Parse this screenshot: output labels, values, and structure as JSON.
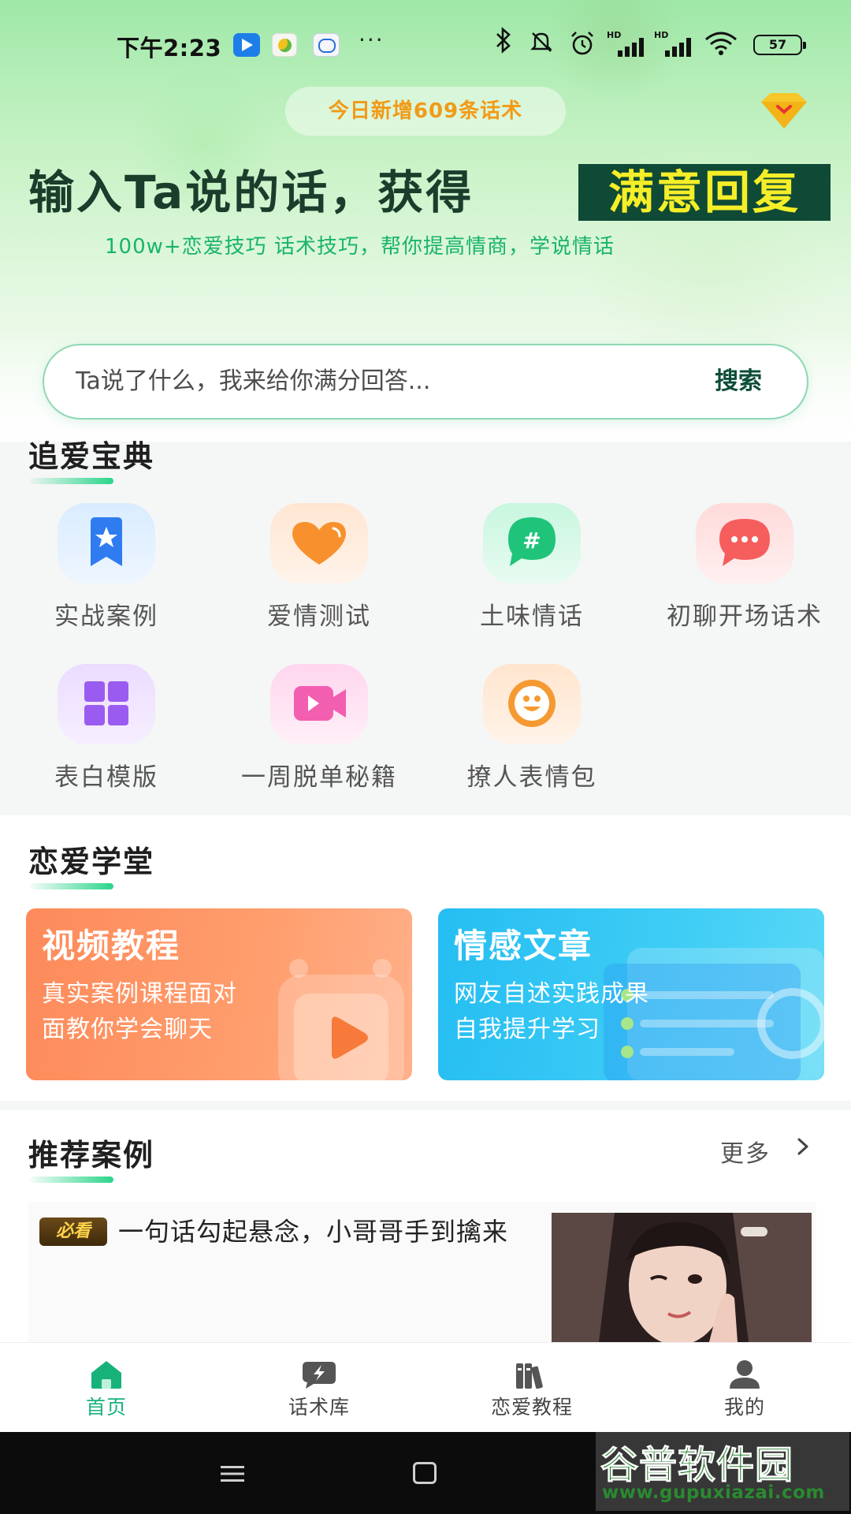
{
  "status_bar": {
    "time": "下午2:23",
    "overflow": "···",
    "battery": "57",
    "signal_label": "HD"
  },
  "hero": {
    "promo": "今日新增609条话术",
    "headline": "输入Ta说的话，获得",
    "headline_highlight": "满意回复",
    "subline": "100w+恋爱技巧 话术技巧，帮你提高情商，学说情话"
  },
  "search": {
    "placeholder": "Ta说了什么，我来给你满分回答...",
    "button": "搜索"
  },
  "guide": {
    "title": "追爱宝典",
    "items": [
      {
        "label": "实战案例",
        "icon": "bookmark-star-icon",
        "color": "#2f7cf0"
      },
      {
        "label": "爱情测试",
        "icon": "heart-icon",
        "color": "#f8912d"
      },
      {
        "label": "土味情话",
        "icon": "hashtag-chat-icon",
        "color": "#1fc47a"
      },
      {
        "label": "初聊开场话术",
        "icon": "chat-bubble-icon",
        "color": "#f65d5d"
      },
      {
        "label": "表白模版",
        "icon": "template-grid-icon",
        "color": "#9a5cf0"
      },
      {
        "label": "一周脱单秘籍",
        "icon": "video-icon",
        "color": "#f25fb0"
      },
      {
        "label": "撩人表情包",
        "icon": "smiley-icon",
        "color": "#f59a33"
      }
    ]
  },
  "school": {
    "title": "恋爱学堂",
    "cards": [
      {
        "title": "视频教程",
        "desc_1": "真实案例课程面对",
        "desc_2": "面教你学会聊天",
        "color": "#fb8f5f"
      },
      {
        "title": "情感文章",
        "desc_1": "网友自述实践成果",
        "desc_2": "自我提升学习",
        "color": "#2fc6f2"
      }
    ]
  },
  "recommend": {
    "title": "推荐案例",
    "more": "更多",
    "article": {
      "badge": "必看",
      "title": "一句话勾起悬念，小哥哥手到擒来"
    }
  },
  "tabbar": {
    "tabs": [
      {
        "label": "首页",
        "icon": "home-icon",
        "active": true
      },
      {
        "label": "话术库",
        "icon": "lightning-chat-icon",
        "active": false
      },
      {
        "label": "恋爱教程",
        "icon": "books-icon",
        "active": false
      },
      {
        "label": "我的",
        "icon": "user-icon",
        "active": false
      }
    ],
    "active_color": "#17b27a",
    "inactive_color": "#444444"
  },
  "watermark": {
    "title": "谷普软件园",
    "url": "www.gupuxiazai.com"
  }
}
